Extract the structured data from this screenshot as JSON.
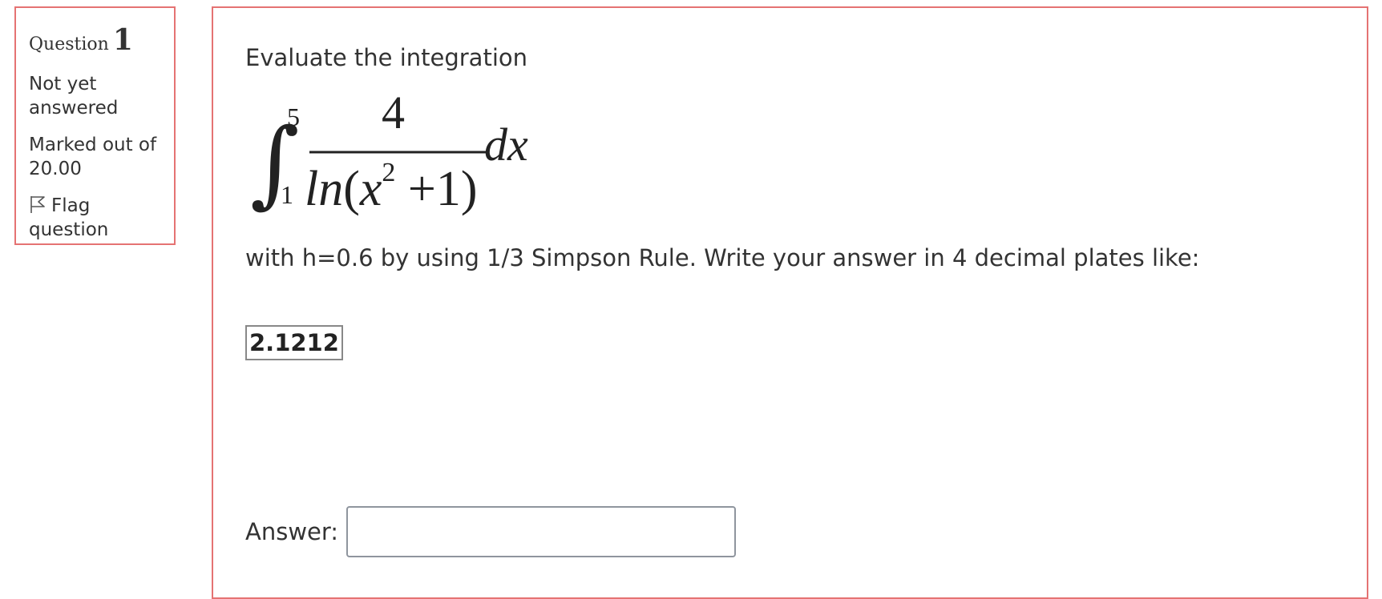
{
  "question_info": {
    "label": "Question",
    "number": "1",
    "state": "Not yet answered",
    "grade": "Marked out of 20.00",
    "flag_label": "Flag question"
  },
  "question": {
    "intro": "Evaluate the integration",
    "formula": {
      "integral_sign": "∫",
      "upper_limit": "5",
      "lower_limit": "1",
      "numerator": "4",
      "denominator_ln": "ln",
      "denominator_open": "(",
      "denominator_var": "x",
      "denominator_exp": "2",
      "denominator_tail": " +1)",
      "differential": "dx"
    },
    "instruction": "with h=0.6 by using 1/3 Simpson Rule. Write your answer in 4 decimal plates like:",
    "example_value": "2.1212"
  },
  "answer": {
    "label": "Answer:",
    "value": ""
  },
  "colors": {
    "panel_border": "#e57373",
    "text": "#333333",
    "input_border": "#8f959e"
  }
}
